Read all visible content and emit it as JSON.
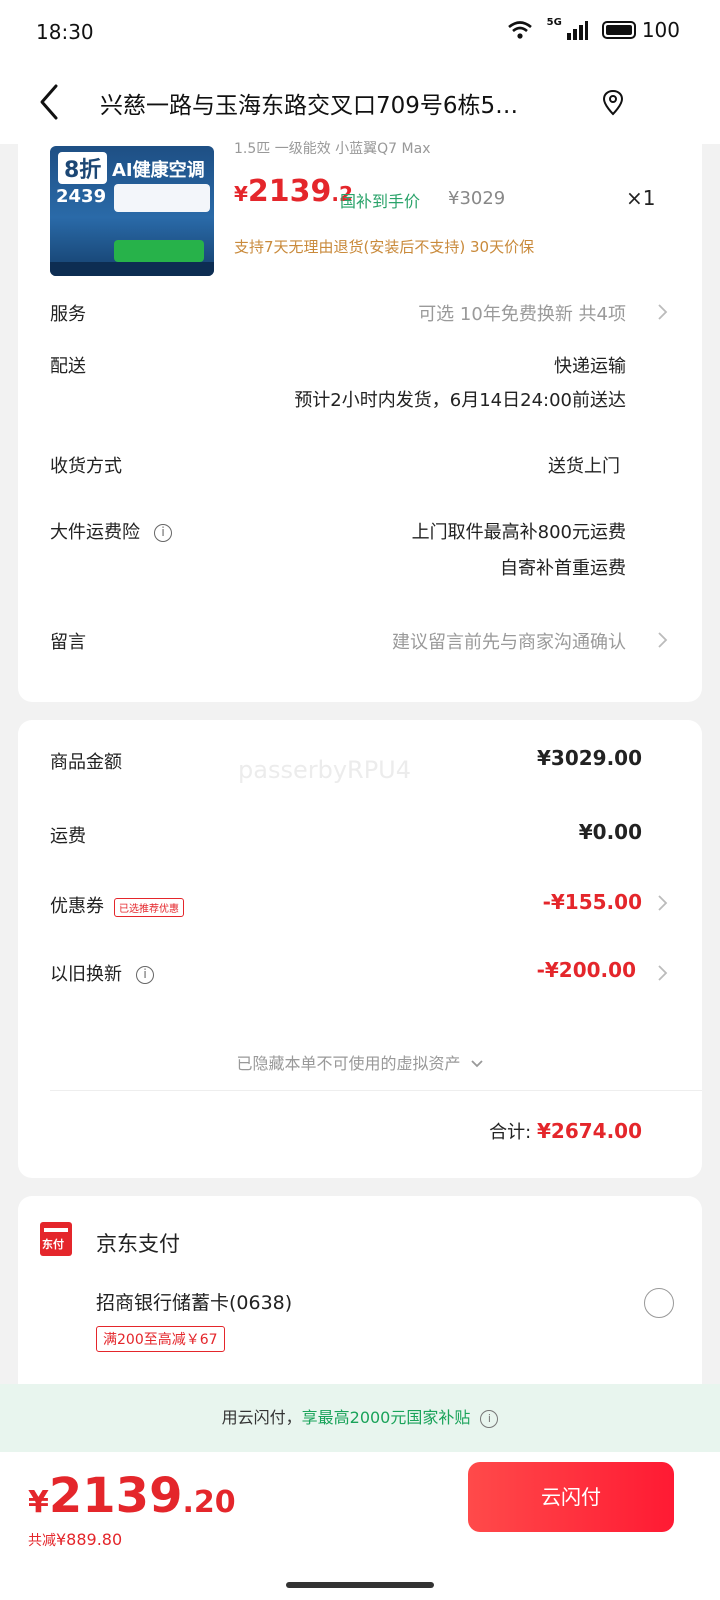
{
  "status": {
    "time": "18:30",
    "network": "5G",
    "battery": "100"
  },
  "nav": {
    "address": "兴慈一路与玉海东路交叉口709号6栋5…"
  },
  "product": {
    "image_texts": {
      "discount": "8折",
      "headline": "AI健康空调",
      "price": "2439"
    },
    "spec": "1.5匹 一级能效 小蓝翼Q7 Max",
    "price_currency": "¥",
    "price_int": "2139",
    "price_dec": ".2",
    "subsidy_label": "国补到手价",
    "original_price": "¥3029",
    "quantity": "×1",
    "note": "支持7天无理由退货(安装后不支持)  30天价保"
  },
  "order": {
    "service": {
      "label": "服务",
      "value": "可选  10年免费换新 共4项"
    },
    "delivery": {
      "label": "配送",
      "value_line1": "快递运输",
      "value_line2": "预计2小时内发货，6月14日24:00前送达"
    },
    "receive": {
      "label": "收货方式",
      "value": "送货上门"
    },
    "freight_insurance": {
      "label": "大件运费险",
      "value_line1": "上门取件最高补800元运费",
      "value_line2": "自寄补首重运费"
    },
    "message": {
      "label": "留言",
      "placeholder": "建议留言前先与商家沟通确认"
    }
  },
  "summary": {
    "watermark": "passerbyRPU4",
    "goods": {
      "label": "商品金额",
      "value": "¥3029.00"
    },
    "shipping": {
      "label": "运费",
      "value": "¥0.00"
    },
    "coupon": {
      "label": "优惠券",
      "tag": "已选推荐优惠",
      "value": "-¥155.00"
    },
    "tradein": {
      "label": "以旧换新",
      "value": "-¥200.00"
    },
    "hidden_assets": "已隐藏本单不可使用的虚拟资产",
    "total_label": "合计:",
    "total_value": "¥2674.00"
  },
  "payment": {
    "icon_text": "东付",
    "title": "京东支付",
    "bank": "招商银行储蓄卡(0638)",
    "bank_promo": "满200至高减￥67"
  },
  "banner": {
    "prefix": "用云闪付，",
    "highlight": "享最高2000元国家补贴"
  },
  "bottom": {
    "currency": "¥",
    "price_int": "2139",
    "price_dec": ".20",
    "saved_label": "共减",
    "saved_value": "¥889.80",
    "pay_button": "云闪付"
  },
  "colors": {
    "accent": "#e4262b",
    "green": "#1aa35a",
    "gold": "#c98a3b"
  }
}
